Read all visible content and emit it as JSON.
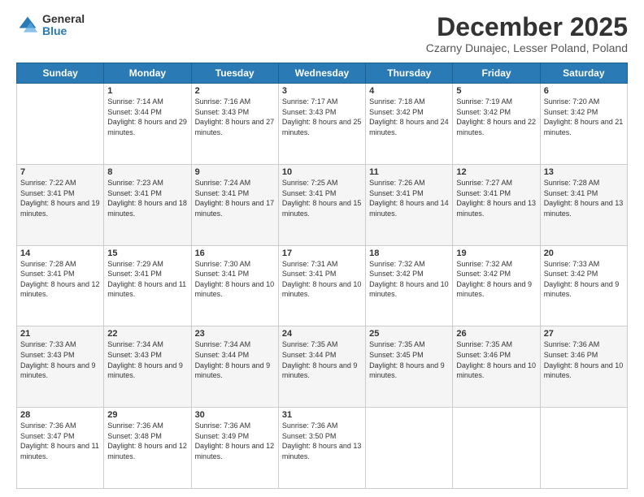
{
  "logo": {
    "general": "General",
    "blue": "Blue"
  },
  "header": {
    "month": "December 2025",
    "location": "Czarny Dunajec, Lesser Poland, Poland"
  },
  "weekdays": [
    "Sunday",
    "Monday",
    "Tuesday",
    "Wednesday",
    "Thursday",
    "Friday",
    "Saturday"
  ],
  "weeks": [
    [
      {
        "day": "",
        "sunrise": "",
        "sunset": "",
        "daylight": ""
      },
      {
        "day": "1",
        "sunrise": "Sunrise: 7:14 AM",
        "sunset": "Sunset: 3:44 PM",
        "daylight": "Daylight: 8 hours and 29 minutes."
      },
      {
        "day": "2",
        "sunrise": "Sunrise: 7:16 AM",
        "sunset": "Sunset: 3:43 PM",
        "daylight": "Daylight: 8 hours and 27 minutes."
      },
      {
        "day": "3",
        "sunrise": "Sunrise: 7:17 AM",
        "sunset": "Sunset: 3:43 PM",
        "daylight": "Daylight: 8 hours and 25 minutes."
      },
      {
        "day": "4",
        "sunrise": "Sunrise: 7:18 AM",
        "sunset": "Sunset: 3:42 PM",
        "daylight": "Daylight: 8 hours and 24 minutes."
      },
      {
        "day": "5",
        "sunrise": "Sunrise: 7:19 AM",
        "sunset": "Sunset: 3:42 PM",
        "daylight": "Daylight: 8 hours and 22 minutes."
      },
      {
        "day": "6",
        "sunrise": "Sunrise: 7:20 AM",
        "sunset": "Sunset: 3:42 PM",
        "daylight": "Daylight: 8 hours and 21 minutes."
      }
    ],
    [
      {
        "day": "7",
        "sunrise": "Sunrise: 7:22 AM",
        "sunset": "Sunset: 3:41 PM",
        "daylight": "Daylight: 8 hours and 19 minutes."
      },
      {
        "day": "8",
        "sunrise": "Sunrise: 7:23 AM",
        "sunset": "Sunset: 3:41 PM",
        "daylight": "Daylight: 8 hours and 18 minutes."
      },
      {
        "day": "9",
        "sunrise": "Sunrise: 7:24 AM",
        "sunset": "Sunset: 3:41 PM",
        "daylight": "Daylight: 8 hours and 17 minutes."
      },
      {
        "day": "10",
        "sunrise": "Sunrise: 7:25 AM",
        "sunset": "Sunset: 3:41 PM",
        "daylight": "Daylight: 8 hours and 15 minutes."
      },
      {
        "day": "11",
        "sunrise": "Sunrise: 7:26 AM",
        "sunset": "Sunset: 3:41 PM",
        "daylight": "Daylight: 8 hours and 14 minutes."
      },
      {
        "day": "12",
        "sunrise": "Sunrise: 7:27 AM",
        "sunset": "Sunset: 3:41 PM",
        "daylight": "Daylight: 8 hours and 13 minutes."
      },
      {
        "day": "13",
        "sunrise": "Sunrise: 7:28 AM",
        "sunset": "Sunset: 3:41 PM",
        "daylight": "Daylight: 8 hours and 13 minutes."
      }
    ],
    [
      {
        "day": "14",
        "sunrise": "Sunrise: 7:28 AM",
        "sunset": "Sunset: 3:41 PM",
        "daylight": "Daylight: 8 hours and 12 minutes."
      },
      {
        "day": "15",
        "sunrise": "Sunrise: 7:29 AM",
        "sunset": "Sunset: 3:41 PM",
        "daylight": "Daylight: 8 hours and 11 minutes."
      },
      {
        "day": "16",
        "sunrise": "Sunrise: 7:30 AM",
        "sunset": "Sunset: 3:41 PM",
        "daylight": "Daylight: 8 hours and 10 minutes."
      },
      {
        "day": "17",
        "sunrise": "Sunrise: 7:31 AM",
        "sunset": "Sunset: 3:41 PM",
        "daylight": "Daylight: 8 hours and 10 minutes."
      },
      {
        "day": "18",
        "sunrise": "Sunrise: 7:32 AM",
        "sunset": "Sunset: 3:42 PM",
        "daylight": "Daylight: 8 hours and 10 minutes."
      },
      {
        "day": "19",
        "sunrise": "Sunrise: 7:32 AM",
        "sunset": "Sunset: 3:42 PM",
        "daylight": "Daylight: 8 hours and 9 minutes."
      },
      {
        "day": "20",
        "sunrise": "Sunrise: 7:33 AM",
        "sunset": "Sunset: 3:42 PM",
        "daylight": "Daylight: 8 hours and 9 minutes."
      }
    ],
    [
      {
        "day": "21",
        "sunrise": "Sunrise: 7:33 AM",
        "sunset": "Sunset: 3:43 PM",
        "daylight": "Daylight: 8 hours and 9 minutes."
      },
      {
        "day": "22",
        "sunrise": "Sunrise: 7:34 AM",
        "sunset": "Sunset: 3:43 PM",
        "daylight": "Daylight: 8 hours and 9 minutes."
      },
      {
        "day": "23",
        "sunrise": "Sunrise: 7:34 AM",
        "sunset": "Sunset: 3:44 PM",
        "daylight": "Daylight: 8 hours and 9 minutes."
      },
      {
        "day": "24",
        "sunrise": "Sunrise: 7:35 AM",
        "sunset": "Sunset: 3:44 PM",
        "daylight": "Daylight: 8 hours and 9 minutes."
      },
      {
        "day": "25",
        "sunrise": "Sunrise: 7:35 AM",
        "sunset": "Sunset: 3:45 PM",
        "daylight": "Daylight: 8 hours and 9 minutes."
      },
      {
        "day": "26",
        "sunrise": "Sunrise: 7:35 AM",
        "sunset": "Sunset: 3:46 PM",
        "daylight": "Daylight: 8 hours and 10 minutes."
      },
      {
        "day": "27",
        "sunrise": "Sunrise: 7:36 AM",
        "sunset": "Sunset: 3:46 PM",
        "daylight": "Daylight: 8 hours and 10 minutes."
      }
    ],
    [
      {
        "day": "28",
        "sunrise": "Sunrise: 7:36 AM",
        "sunset": "Sunset: 3:47 PM",
        "daylight": "Daylight: 8 hours and 11 minutes."
      },
      {
        "day": "29",
        "sunrise": "Sunrise: 7:36 AM",
        "sunset": "Sunset: 3:48 PM",
        "daylight": "Daylight: 8 hours and 12 minutes."
      },
      {
        "day": "30",
        "sunrise": "Sunrise: 7:36 AM",
        "sunset": "Sunset: 3:49 PM",
        "daylight": "Daylight: 8 hours and 12 minutes."
      },
      {
        "day": "31",
        "sunrise": "Sunrise: 7:36 AM",
        "sunset": "Sunset: 3:50 PM",
        "daylight": "Daylight: 8 hours and 13 minutes."
      },
      {
        "day": "",
        "sunrise": "",
        "sunset": "",
        "daylight": ""
      },
      {
        "day": "",
        "sunrise": "",
        "sunset": "",
        "daylight": ""
      },
      {
        "day": "",
        "sunrise": "",
        "sunset": "",
        "daylight": ""
      }
    ]
  ]
}
